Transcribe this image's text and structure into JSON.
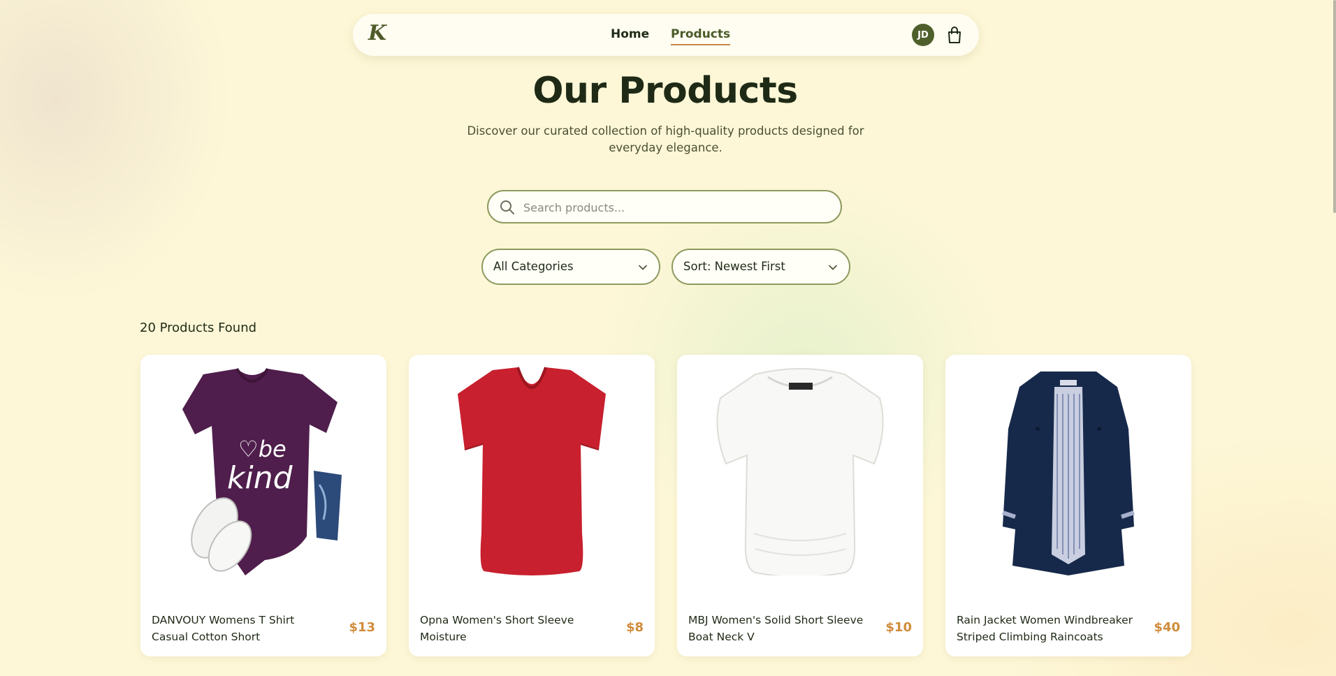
{
  "nav": {
    "logo": "K",
    "links": [
      "Home",
      "Products"
    ],
    "active": "Products",
    "avatar_initials": "JD",
    "cart_icon": "shopping-bag-icon"
  },
  "hero": {
    "title": "Our Products",
    "subtitle": "Discover our curated collection of high-quality products designed for everyday elegance."
  },
  "search": {
    "placeholder": "Search products...",
    "value": ""
  },
  "filters": {
    "category": "All Categories",
    "sort": "Sort: Newest First"
  },
  "results": {
    "count_label": "20 Products Found"
  },
  "products": [
    {
      "name": "DANVOUY Womens T Shirt Casual Cotton Short",
      "price": "$13"
    },
    {
      "name": "Opna Women's Short Sleeve Moisture",
      "price": "$8"
    },
    {
      "name": "MBJ Women's Solid Short Sleeve Boat Neck V",
      "price": "$10"
    },
    {
      "name": "Rain Jacket Women Windbreaker Striped Climbing Raincoats",
      "price": "$40"
    }
  ],
  "colors": {
    "background": "#fdf7d7",
    "accent": "#4f5f2b",
    "price": "#d08c3c",
    "underline": "#c7894a"
  }
}
